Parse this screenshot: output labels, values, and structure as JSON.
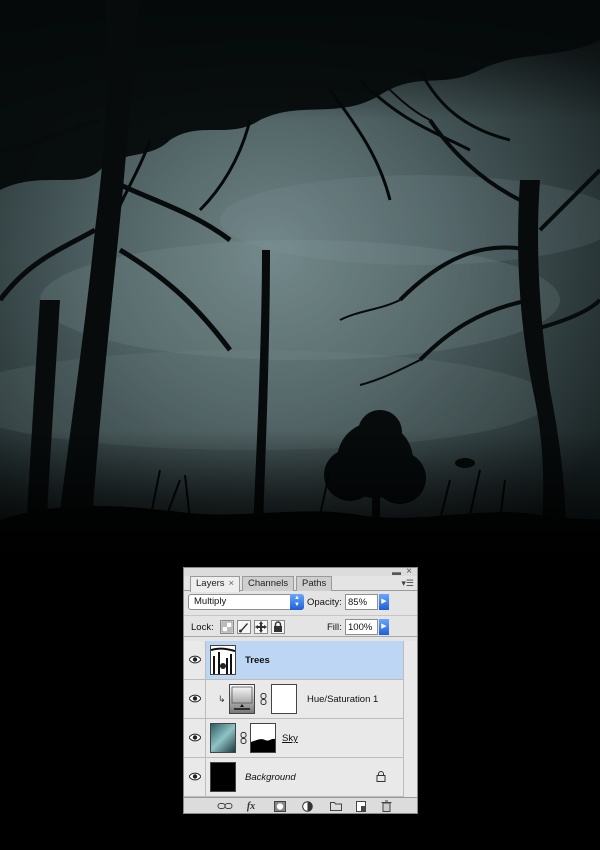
{
  "panel": {
    "tabs": [
      {
        "label": "Layers",
        "active": true
      },
      {
        "label": "Channels",
        "active": false
      },
      {
        "label": "Paths",
        "active": false
      }
    ],
    "blend_mode": "Multiply",
    "opacity_label": "Opacity:",
    "opacity_value": "85%",
    "lock_label": "Lock:",
    "fill_label": "Fill:",
    "fill_value": "100%",
    "layers": [
      {
        "name": "Trees",
        "selected": true,
        "visible": true
      },
      {
        "name": "Hue/Saturation 1",
        "selected": false,
        "visible": true
      },
      {
        "name": "Sky",
        "selected": false,
        "visible": true
      },
      {
        "name": "Background",
        "selected": false,
        "visible": true,
        "locked": true
      }
    ],
    "bottom_icons": [
      "link-icon",
      "fx-icon",
      "mask-icon",
      "adjustment-icon",
      "folder-icon",
      "new-layer-icon",
      "trash-icon"
    ]
  },
  "colors": {
    "selected_row": "#bdd6f4",
    "accent_blue": "#1f5fd6",
    "sky": "#5b6e70"
  }
}
